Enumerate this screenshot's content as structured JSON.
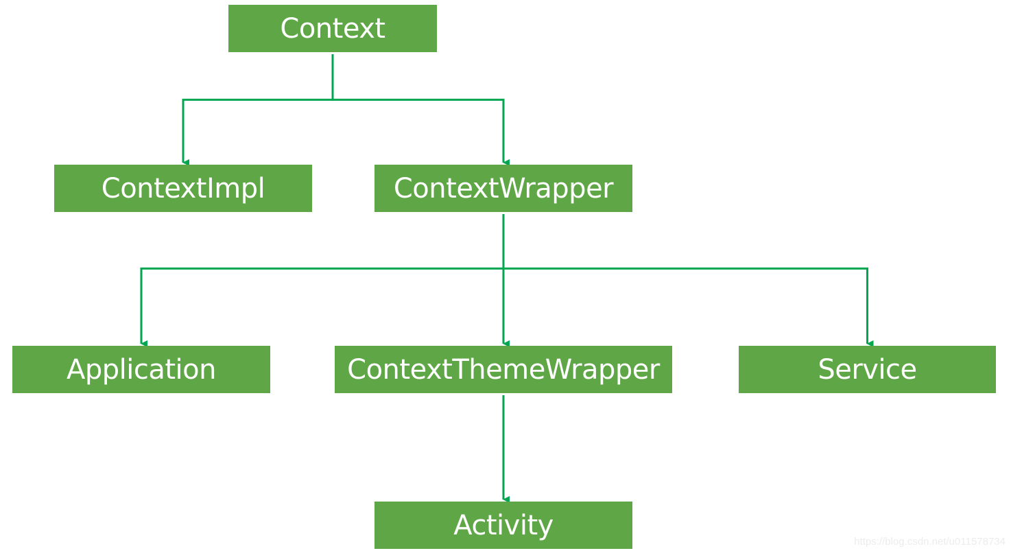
{
  "diagram": {
    "type": "class-hierarchy",
    "colors": {
      "node_fill": "#5fa746",
      "node_text": "#ffffff",
      "edge": "#00a650",
      "watermark": "#ececec"
    },
    "nodes": {
      "context": {
        "label": "Context"
      },
      "contextimpl": {
        "label": "ContextImpl"
      },
      "contextwrapper": {
        "label": "ContextWrapper"
      },
      "application": {
        "label": "Application"
      },
      "contextthemewrapper": {
        "label": "ContextThemeWrapper"
      },
      "service": {
        "label": "Service"
      },
      "activity": {
        "label": "Activity"
      }
    },
    "edges": [
      {
        "from": "context",
        "to": "contextimpl"
      },
      {
        "from": "context",
        "to": "contextwrapper"
      },
      {
        "from": "contextwrapper",
        "to": "application"
      },
      {
        "from": "contextwrapper",
        "to": "contextthemewrapper"
      },
      {
        "from": "contextwrapper",
        "to": "service"
      },
      {
        "from": "contextthemewrapper",
        "to": "activity"
      }
    ]
  },
  "watermark": "https://blog.csdn.net/u011578734"
}
